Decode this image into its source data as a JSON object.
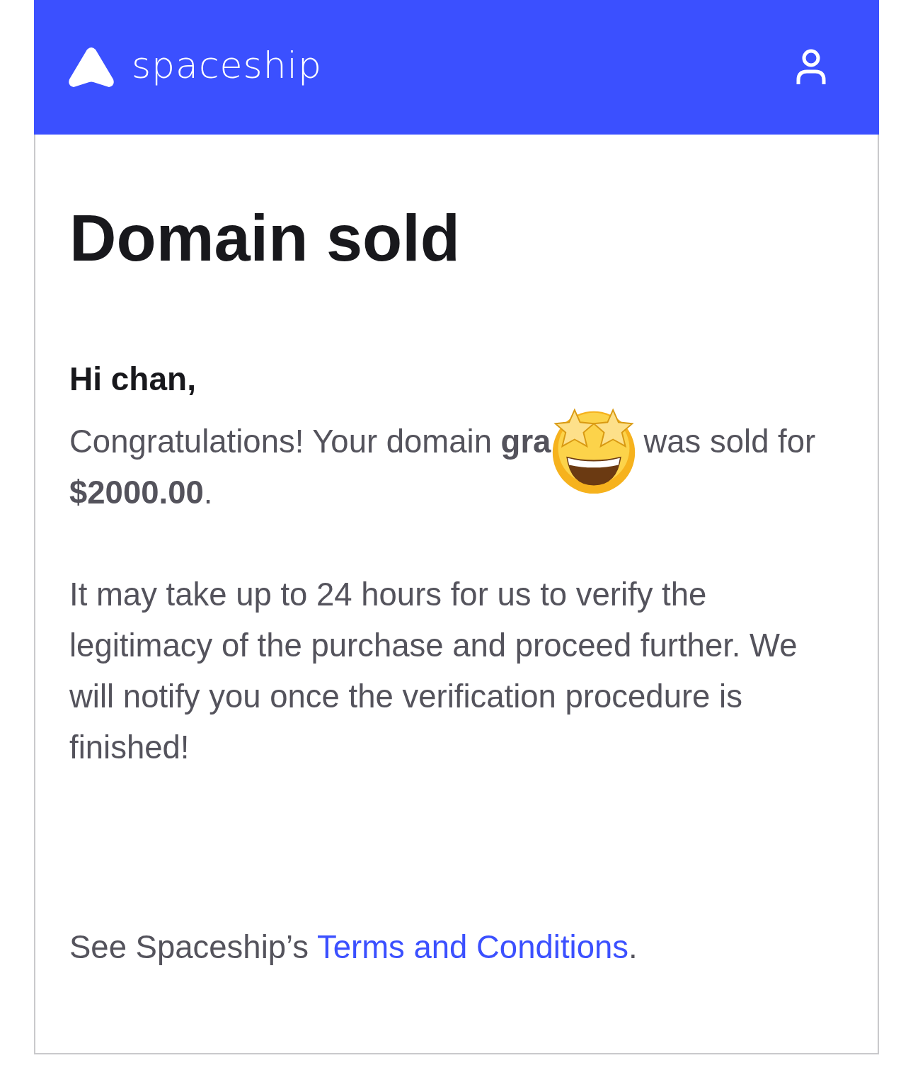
{
  "header": {
    "brand": "spaceship"
  },
  "title": "Domain sold",
  "greeting": "Hi chan,",
  "message": {
    "before_sticker": "Congratulations! Your domain **gra**",
    "after_sticker": "was sold for",
    "amount_line": "**$2000.00**."
  },
  "note": "It may take up to 24 hours for us to verify the legitimacy of the purchase and proceed further. We will notify you once the verification procedure is finished!",
  "footer": {
    "prefix": "See Spaceship’s ",
    "link": "Terms and Conditions",
    "suffix": "."
  }
}
